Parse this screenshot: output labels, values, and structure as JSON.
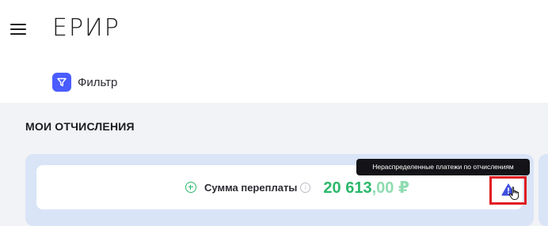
{
  "header": {
    "logo_text": "ЕРИР"
  },
  "filter": {
    "label": "Фильтр"
  },
  "section": {
    "title": "МОИ ОТЧИСЛЕНИЯ"
  },
  "overpayment": {
    "label": "Сумма переплаты",
    "amount_main": "20 613",
    "amount_decimal": ",00 ₽"
  },
  "tooltip": {
    "text": "Нераспределенные платежи по отчислениям"
  },
  "colors": {
    "accent_blue": "#4a5cff",
    "success_green": "#2bb86b",
    "card_blue": "#d9e4f7",
    "highlight_red": "#e11b22"
  }
}
